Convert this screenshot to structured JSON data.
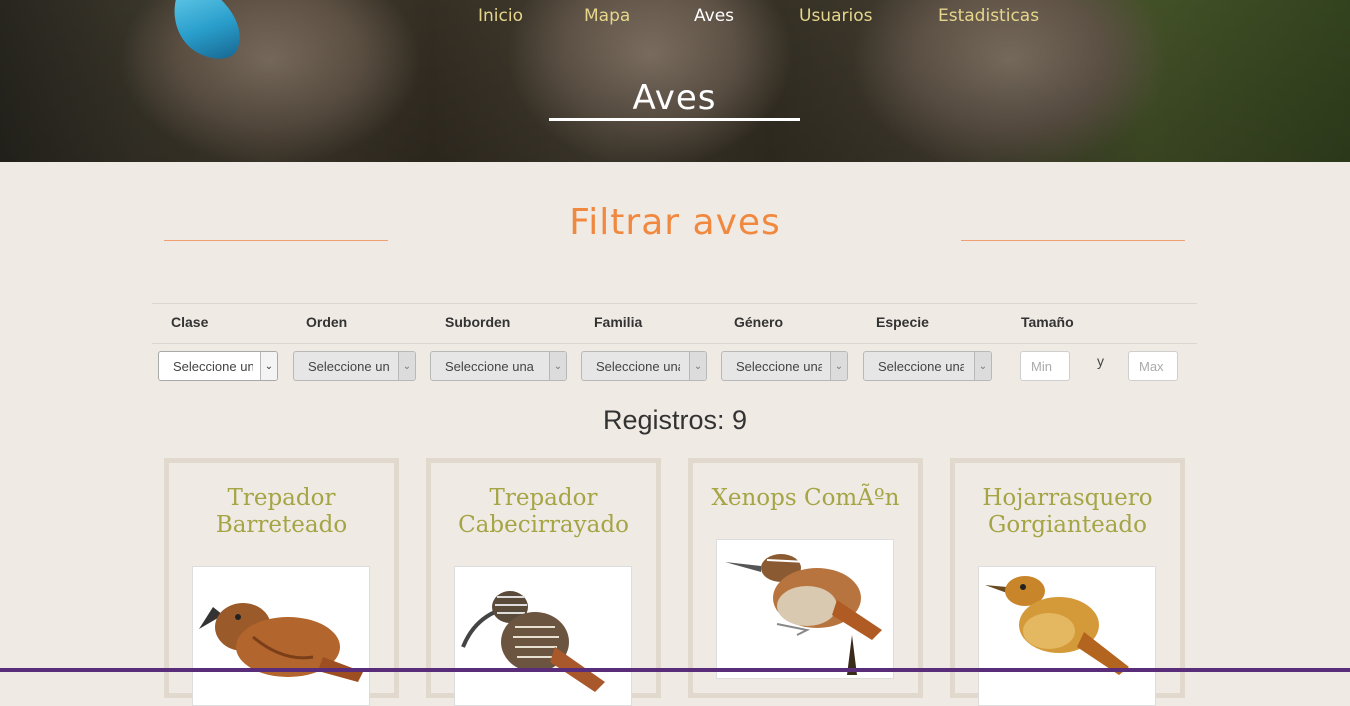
{
  "nav": {
    "items": [
      {
        "label": "Inicio"
      },
      {
        "label": "Mapa"
      },
      {
        "label": "Aves"
      },
      {
        "label": "Usuarios"
      },
      {
        "label": "Estadisticas"
      }
    ],
    "active": "Aves"
  },
  "hero": {
    "title": "Aves"
  },
  "filter": {
    "title": "Filtrar aves",
    "columns": [
      "Clase",
      "Orden",
      "Suborden",
      "Familia",
      "Género",
      "Especie",
      "Tamaño"
    ],
    "selects": [
      {
        "value": "Seleccione una"
      },
      {
        "value": "Seleccione una"
      },
      {
        "value": "Seleccione una"
      },
      {
        "value": "Seleccione una"
      },
      {
        "value": "Seleccione una"
      },
      {
        "value": "Seleccione una"
      }
    ],
    "size_min_placeholder": "Min",
    "size_max_placeholder": "Max",
    "size_separator": "y"
  },
  "records": "Registros: 9",
  "cards": [
    {
      "title_line1": "Trepador",
      "title_line2": "Barreteado",
      "image": "bird-woodcreeper-barred"
    },
    {
      "title_line1": "Trepador",
      "title_line2": "Cabecirrayado",
      "image": "bird-woodcreeper-streak-headed"
    },
    {
      "title_line1": "Xenops ComÃºn",
      "title_line2": "",
      "image": "bird-xenops"
    },
    {
      "title_line1": "Hojarrasquero",
      "title_line2": "Gorgianteado",
      "image": "bird-foliage-gleaner"
    }
  ],
  "colors": {
    "background": "#efeae4",
    "accent_orange": "#f0893f",
    "nav_text": "#e6d68c",
    "card_title": "#a5a545",
    "card_border": "#e2d9ce"
  }
}
